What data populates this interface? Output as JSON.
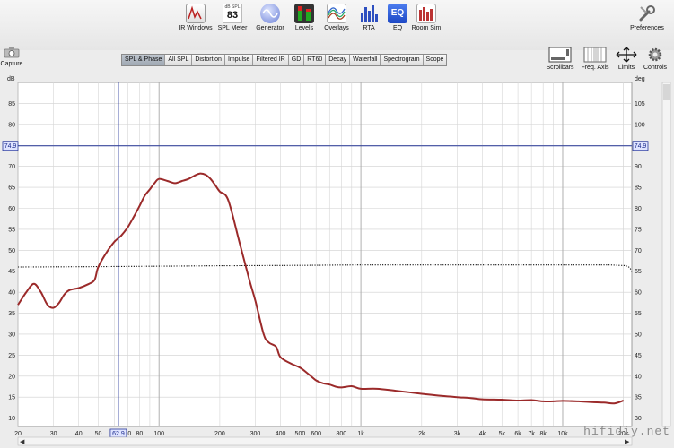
{
  "toolbar": {
    "items": [
      {
        "label": "IR Windows",
        "icon": "ir-windows-icon"
      },
      {
        "label": "SPL Meter",
        "icon": "spl-meter-icon",
        "meter_unit": "dB SPL",
        "meter_value": "83"
      },
      {
        "label": "Generator",
        "icon": "generator-icon"
      },
      {
        "label": "Levels",
        "icon": "levels-icon"
      },
      {
        "label": "Overlays",
        "icon": "overlays-icon"
      },
      {
        "label": "RTA",
        "icon": "rta-icon"
      },
      {
        "label": "EQ",
        "icon": "eq-icon",
        "icon_text": "EQ"
      },
      {
        "label": "Room Sim",
        "icon": "room-sim-icon"
      }
    ],
    "preferences_label": "Preferences"
  },
  "capture_label": "Capture",
  "tabs": [
    "SPL & Phase",
    "All SPL",
    "Distortion",
    "Impulse",
    "Filtered IR",
    "GD",
    "RT60",
    "Decay",
    "Waterfall",
    "Spectrogram",
    "Scope"
  ],
  "active_tab": "SPL & Phase",
  "right_tools": [
    {
      "label": "Scrollbars",
      "icon": "scrollbars-icon"
    },
    {
      "label": "Freq. Axis",
      "icon": "freq-axis-icon"
    },
    {
      "label": "Limits",
      "icon": "limits-icon"
    },
    {
      "label": "Controls",
      "icon": "controls-gear-icon"
    }
  ],
  "watermark": "hifidiy.net",
  "colors": {
    "curve": "#9b2a2a",
    "cursor": "#2a3a9c",
    "grid": "#c8c8c8",
    "plot_bg": "#ffffff"
  },
  "chart_data": {
    "type": "line",
    "left_axis_unit": "dB",
    "right_axis_unit": "deg",
    "y_left_range": [
      8,
      90
    ],
    "y_right_range": [
      28,
      110
    ],
    "y_left_ticks": [
      10,
      15,
      20,
      25,
      30,
      35,
      40,
      45,
      50,
      55,
      60,
      65,
      70,
      75,
      80,
      85
    ],
    "y_right_ticks": [
      30,
      35,
      40,
      45,
      50,
      55,
      60,
      65,
      70,
      75,
      80,
      85,
      90,
      95,
      100,
      105
    ],
    "x_scale": "log",
    "x_range": [
      20,
      22000
    ],
    "x_ticks": [
      {
        "v": 20,
        "t": "20"
      },
      {
        "v": 30,
        "t": "30"
      },
      {
        "v": 40,
        "t": "40"
      },
      {
        "v": 50,
        "t": "50"
      },
      {
        "v": 60,
        "t": "60"
      },
      {
        "v": 70,
        "t": "70"
      },
      {
        "v": 80,
        "t": "80"
      },
      {
        "v": 100,
        "t": "100"
      },
      {
        "v": 200,
        "t": "200"
      },
      {
        "v": 300,
        "t": "300"
      },
      {
        "v": 400,
        "t": "400"
      },
      {
        "v": 500,
        "t": "500"
      },
      {
        "v": 600,
        "t": "600"
      },
      {
        "v": 800,
        "t": "800"
      },
      {
        "v": 1000,
        "t": "1k"
      },
      {
        "v": 2000,
        "t": "2k"
      },
      {
        "v": 3000,
        "t": "3k"
      },
      {
        "v": 4000,
        "t": "4k"
      },
      {
        "v": 5000,
        "t": "5k"
      },
      {
        "v": 6000,
        "t": "6k"
      },
      {
        "v": 7000,
        "t": "7k"
      },
      {
        "v": 8000,
        "t": "8k"
      },
      {
        "v": 10000,
        "t": "10k"
      },
      {
        "v": 20000,
        "t": "20k"
      }
    ],
    "cursor": {
      "freq_label": "62.9",
      "freq": 62.9,
      "level_label": "74.9",
      "level": 74.9
    },
    "series": [
      {
        "style": "solid",
        "x": [
          20,
          22,
          24,
          26,
          28,
          30,
          32,
          34,
          36,
          40,
          45,
          48,
          50,
          55,
          60,
          65,
          70,
          75,
          80,
          85,
          90,
          95,
          100,
          110,
          120,
          130,
          140,
          150,
          160,
          170,
          180,
          190,
          200,
          220,
          250,
          280,
          300,
          330,
          350,
          380,
          400,
          450,
          500,
          550,
          600,
          650,
          700,
          750,
          800,
          900,
          1000,
          1200,
          1500,
          2000,
          2500,
          3000,
          3500,
          4000,
          5000,
          6000,
          7000,
          8000,
          9000,
          10000,
          12000,
          14000,
          16000,
          18000,
          20000
        ],
        "y": [
          37,
          40,
          42,
          40,
          37,
          36.3,
          37.5,
          39.5,
          40.5,
          41,
          42,
          43,
          46,
          49.5,
          52,
          53.5,
          55.5,
          58,
          60.5,
          63,
          64.5,
          66,
          67,
          66.5,
          66,
          66.5,
          67,
          67.8,
          68.3,
          68,
          67,
          65.5,
          64,
          62,
          52,
          43,
          38,
          30,
          28,
          27,
          24.5,
          23,
          22,
          20.5,
          19,
          18.3,
          18,
          17.5,
          17.3,
          17.6,
          17,
          17,
          16.5,
          15.8,
          15.3,
          15,
          14.8,
          14.5,
          14.4,
          14.2,
          14.3,
          14,
          14,
          14.1,
          14,
          13.8,
          13.7,
          13.5,
          14.2
        ]
      },
      {
        "style": "dotted",
        "x": [
          20,
          50,
          100,
          200,
          500,
          1000,
          2000,
          5000,
          10000,
          15000,
          17000,
          19000,
          20500,
          21500,
          22000
        ],
        "y": [
          46,
          46.1,
          46.2,
          46.3,
          46.4,
          46.5,
          46.5,
          46.5,
          46.5,
          46.5,
          46.5,
          46.4,
          46.3,
          45.8,
          44.8
        ]
      }
    ]
  }
}
